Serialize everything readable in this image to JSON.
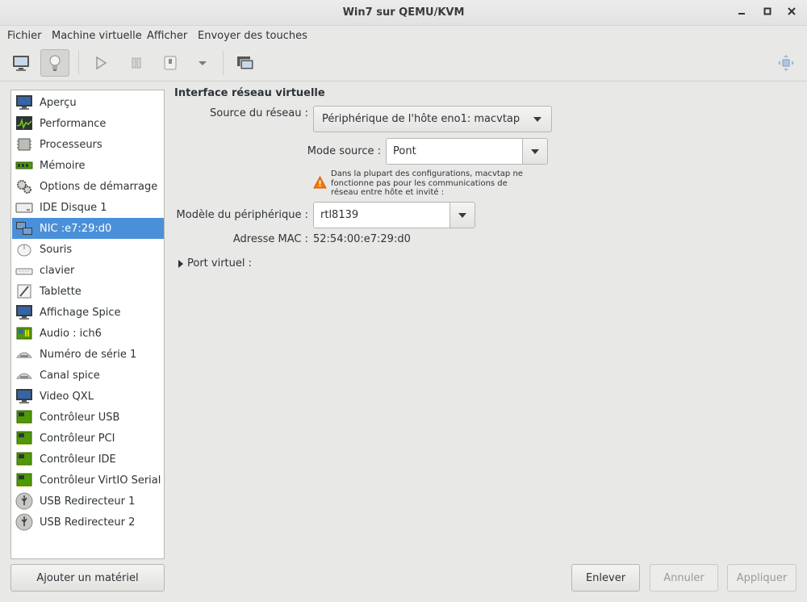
{
  "window": {
    "title": "Win7 sur QEMU/KVM"
  },
  "menu": [
    "Fichier",
    "Machine virtuelle",
    "Afficher",
    "Envoyer des touches"
  ],
  "toolbar": {
    "icons": [
      "monitor-icon",
      "lightbulb-icon",
      "play-icon",
      "pause-icon",
      "power-icon",
      "dropdown-arrow-icon",
      "snapshots-icon",
      "fullscreen-icon"
    ]
  },
  "sidebar": {
    "items": [
      {
        "label": "Aperçu",
        "icon": "monitor-info-icon"
      },
      {
        "label": "Performance",
        "icon": "performance-graph-icon"
      },
      {
        "label": "Processeurs",
        "icon": "cpu-chip-icon"
      },
      {
        "label": "Mémoire",
        "icon": "memory-icon"
      },
      {
        "label": "Options de démarrage",
        "icon": "gears-icon"
      },
      {
        "label": "IDE Disque 1",
        "icon": "hard-disk-icon"
      },
      {
        "label": "NIC :e7:29:d0",
        "icon": "network-icon",
        "selected": true
      },
      {
        "label": "Souris",
        "icon": "mouse-icon"
      },
      {
        "label": "clavier",
        "icon": "keyboard-icon"
      },
      {
        "label": "Tablette",
        "icon": "tablet-icon"
      },
      {
        "label": "Affichage Spice",
        "icon": "display-icon"
      },
      {
        "label": "Audio : ich6",
        "icon": "audio-card-icon"
      },
      {
        "label": "Numéro de série 1",
        "icon": "serial-icon"
      },
      {
        "label": "Canal spice",
        "icon": "channel-icon"
      },
      {
        "label": "Video QXL",
        "icon": "video-icon"
      },
      {
        "label": "Contrôleur USB",
        "icon": "controller-card-icon"
      },
      {
        "label": "Contrôleur PCI",
        "icon": "controller-card-icon"
      },
      {
        "label": "Contrôleur IDE",
        "icon": "controller-card-icon"
      },
      {
        "label": "Contrôleur VirtIO Serial",
        "icon": "controller-card-icon"
      },
      {
        "label": "USB Redirecteur 1",
        "icon": "usb-icon"
      },
      {
        "label": "USB Redirecteur 2",
        "icon": "usb-icon"
      }
    ],
    "add_button": "Ajouter un matériel"
  },
  "main": {
    "section_title": "Interface réseau virtuelle",
    "source_label": "Source du réseau :",
    "source_value": "Périphérique de l'hôte eno1: macvtap",
    "mode_label": "Mode source :",
    "mode_value": "Pont",
    "warning": "Dans la plupart des configurations, macvtap ne fonctionne pas pour les communications de réseau entre hôte et invité :",
    "model_label": "Modèle du périphérique :",
    "model_value": "rtl8139",
    "mac_label": "Adresse MAC :",
    "mac_value": "52:54:00:e7:29:d0",
    "virtual_port_label": "Port virtuel :"
  },
  "buttons": {
    "remove": "Enlever",
    "cancel": "Annuler",
    "apply": "Appliquer"
  },
  "colors": {
    "selection": "#4a90d9",
    "background": "#e8e8e7"
  }
}
